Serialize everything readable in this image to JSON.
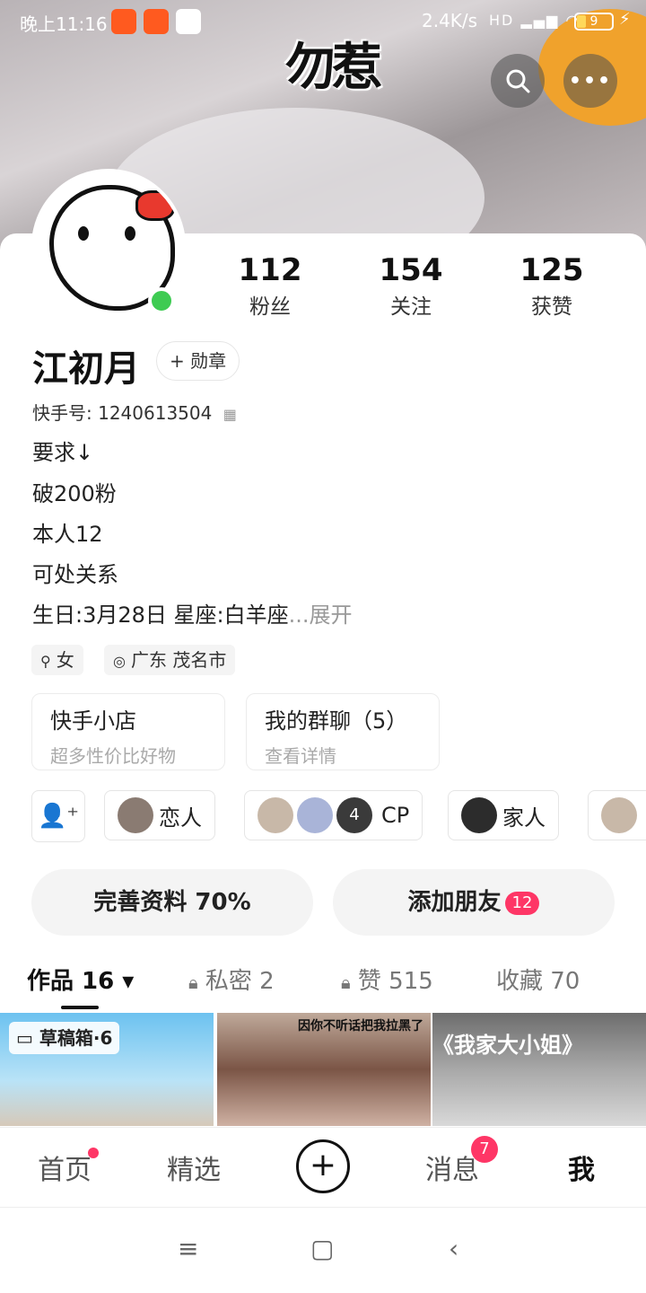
{
  "status_bar": {
    "time": "晚上11:16",
    "net_speed": "2.4K/s",
    "signal": "HD",
    "battery": "9"
  },
  "banner": {
    "sticker_text": "勿惹"
  },
  "header_actions": {
    "search_icon": "search-icon",
    "more_icon": "more-icon"
  },
  "profile": {
    "name": "江初月",
    "medal_label": "+ 勋章",
    "kwai_id_label": "快手号:",
    "kwai_id": "1240613504",
    "online": true
  },
  "stats": [
    {
      "value": "112",
      "label": "粉丝"
    },
    {
      "value": "154",
      "label": "关注"
    },
    {
      "value": "125",
      "label": "获赞"
    }
  ],
  "bio": {
    "lines": [
      "要求↓",
      "破200粉",
      "本人12",
      "可处关系",
      "生日:3月28日 星座:白羊座"
    ],
    "more": "...展开"
  },
  "tags": {
    "gender": "女",
    "location": "广东 茂名市"
  },
  "features": [
    {
      "title": "快手小店",
      "subtitle": "超多性价比好物"
    },
    {
      "title": "我的群聊（5）",
      "subtitle": "查看详情"
    }
  ],
  "relations": [
    {
      "label": "恋人"
    },
    {
      "label": "CP",
      "extra_count": "4"
    },
    {
      "label": "家人"
    }
  ],
  "actions": {
    "complete_profile": "完善资料 70%",
    "add_friend": "添加朋友",
    "add_friend_badge": "12"
  },
  "tabs": [
    {
      "label": "作品 16 ▾",
      "active": true
    },
    {
      "label": "私密 2",
      "locked": true
    },
    {
      "label": "赞 515",
      "locked": true
    },
    {
      "label": "收藏 70"
    }
  ],
  "works": {
    "draft_label": "草稿箱·6",
    "thumb2_caption": "因你不听话把我拉黑了",
    "thumb3_caption": "《我家大小姐》"
  },
  "bottom_nav": {
    "home": "首页",
    "featured": "精选",
    "messages": "消息",
    "messages_badge": "7",
    "me": "我"
  },
  "colors": {
    "accent": "#fe3666",
    "online": "#3ecb52"
  }
}
